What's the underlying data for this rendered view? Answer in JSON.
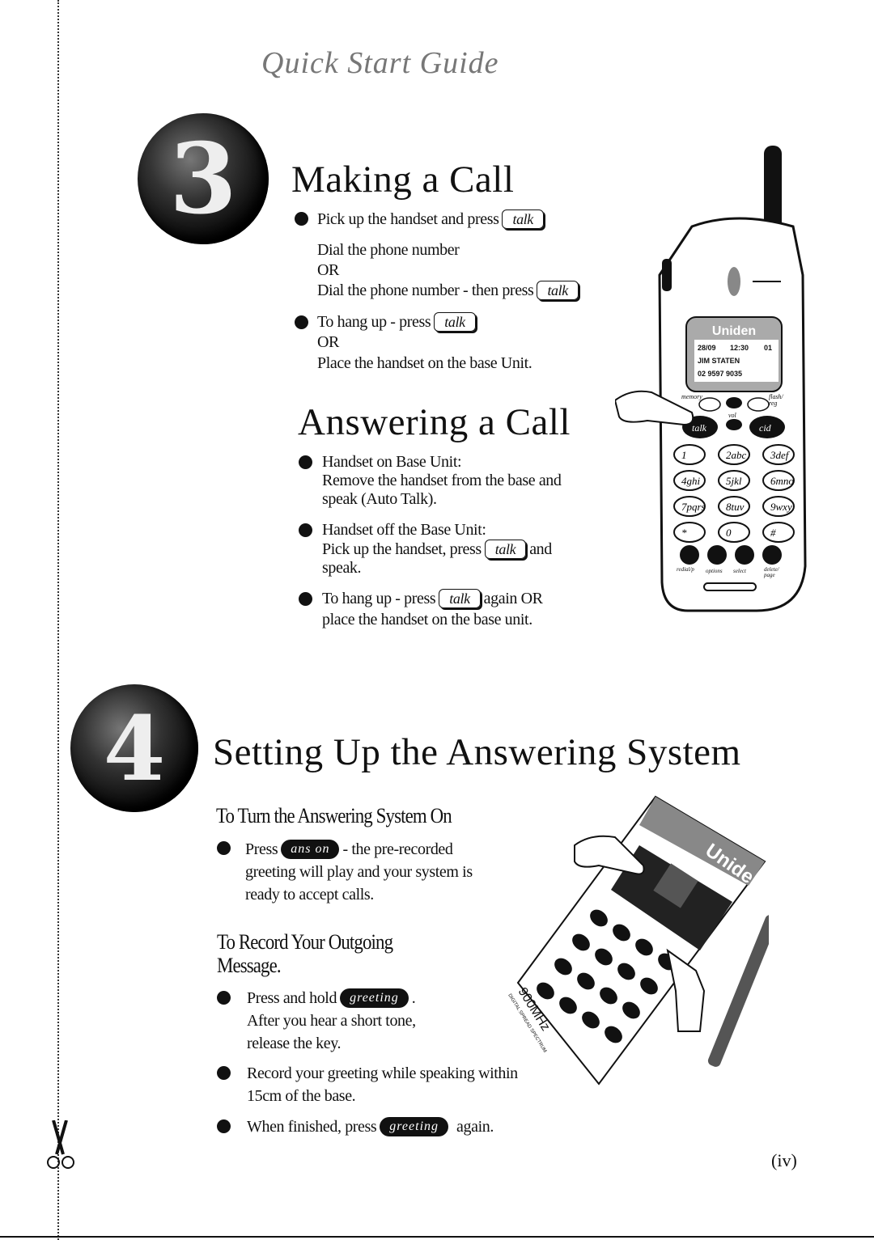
{
  "header": {
    "title": "Quick Start Guide"
  },
  "step3": {
    "number": "3",
    "title": "Making a Call",
    "l1": "Pick up the handset and press",
    "l2": "Dial the phone number",
    "l3": "OR",
    "l4": "Dial the phone number - then press",
    "l5": "To hang up - press",
    "l6": "OR",
    "l7": "Place the handset on the base Unit."
  },
  "answer": {
    "title": "Answering a Call",
    "l1": "Handset on Base Unit:",
    "l2": "Remove the handset from the base and",
    "l3": "speak (Auto Talk).",
    "l4": "Handset off the Base Unit:",
    "l5": "Pick up the handset, press",
    "l5b": "and",
    "l6": "speak.",
    "l7": "To hang up - press",
    "l7b": "again OR",
    "l8": "place the handset on the base unit."
  },
  "keys": {
    "talk": "talk",
    "ans_on": "ans on",
    "greeting": "greeting"
  },
  "step4": {
    "number": "4",
    "title": "Setting Up the Answering System",
    "sub1": "To Turn the Answering System On",
    "a1": "Press",
    "a1b": "- the pre-recorded",
    "a2": "greeting will play and your system is",
    "a3": "ready to accept calls.",
    "sub2a": "To Record Your Outgoing",
    "sub2b": "Message.",
    "b1": "Press and hold",
    "b1b": ".",
    "b2": "After you hear a short tone,",
    "b3": "release the key.",
    "b4": "Record your greeting while speaking within",
    "b5": "15cm of the base.",
    "b6": "When finished, press",
    "b6b": "again."
  },
  "handset": {
    "brand": "Uniden",
    "date": "28/09",
    "time": "12:30",
    "count": "01",
    "name": "JIM STATEN",
    "number": "02 9597 9035",
    "labels": {
      "memory": "memory",
      "flash": "flash/",
      "reg": "reg",
      "vol": "vol",
      "talk": "talk",
      "cid": "cid",
      "redial": "redial/p",
      "options": "options",
      "select": "select",
      "delete": "delete/",
      "page": "page"
    },
    "keys": [
      "1",
      "2abc",
      "3def",
      "4ghi",
      "5jkl",
      "6mno",
      "7pqrs",
      "8tuv",
      "9wxy",
      "*",
      "0",
      "#"
    ]
  },
  "base": {
    "brand": "Uniden",
    "band": "900MHz",
    "band_sub": "DIGITAL SPREAD SPECTRUM"
  },
  "footer": {
    "page": "(iv)"
  }
}
